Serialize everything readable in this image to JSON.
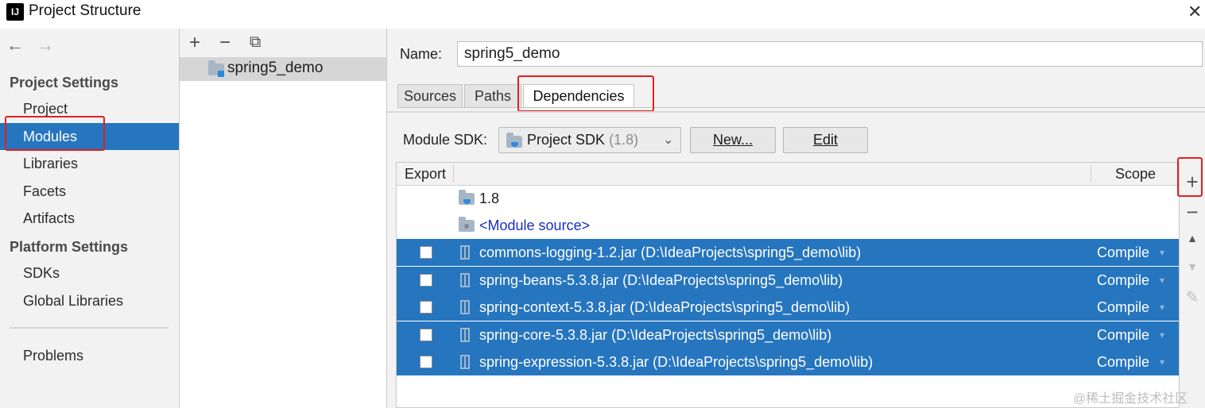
{
  "window": {
    "title": "Project Structure",
    "icon_text": "IJ"
  },
  "icons": {
    "back": "←",
    "forward": "→",
    "close": "✕",
    "add": "+",
    "remove": "−",
    "copy": "⧉",
    "chevron": "⌄",
    "up": "▲",
    "down": "▼",
    "edit": "✎",
    "dropdown": "▾"
  },
  "sidebar": {
    "project_settings_header": "Project Settings",
    "platform_settings_header": "Platform Settings",
    "items": [
      "Project",
      "Modules",
      "Libraries",
      "Facets",
      "Artifacts"
    ],
    "platform_items": [
      "SDKs",
      "Global Libraries"
    ],
    "problems": "Problems",
    "selected": "Modules"
  },
  "modules": {
    "list": [
      "spring5_demo"
    ]
  },
  "detail": {
    "name_label": "Name:",
    "name_value": "spring5_demo",
    "tabs": [
      "Sources",
      "Paths",
      "Dependencies"
    ],
    "active_tab": "Dependencies",
    "sdk_label": "Module SDK:",
    "sdk_value": "Project SDK",
    "sdk_version": "(1.8)",
    "new_button": "New...",
    "edit_button": "Edit"
  },
  "dependencies": {
    "header_export": "Export",
    "header_scope": "Scope",
    "jdk": "1.8",
    "module_source": "<Module source>",
    "rows": [
      {
        "name": "commons-logging-1.2.jar (D:\\IdeaProjects\\spring5_demo\\lib)",
        "scope": "Compile"
      },
      {
        "name": "spring-beans-5.3.8.jar (D:\\IdeaProjects\\spring5_demo\\lib)",
        "scope": "Compile"
      },
      {
        "name": "spring-context-5.3.8.jar (D:\\IdeaProjects\\spring5_demo\\lib)",
        "scope": "Compile"
      },
      {
        "name": "spring-core-5.3.8.jar (D:\\IdeaProjects\\spring5_demo\\lib)",
        "scope": "Compile"
      },
      {
        "name": "spring-expression-5.3.8.jar (D:\\IdeaProjects\\spring5_demo\\lib)",
        "scope": "Compile"
      }
    ]
  },
  "watermark": "@稀土掘金技术社区",
  "colors": {
    "selection": "#2675bf",
    "highlight_box": "#e02020",
    "link": "#1a2fc4"
  }
}
